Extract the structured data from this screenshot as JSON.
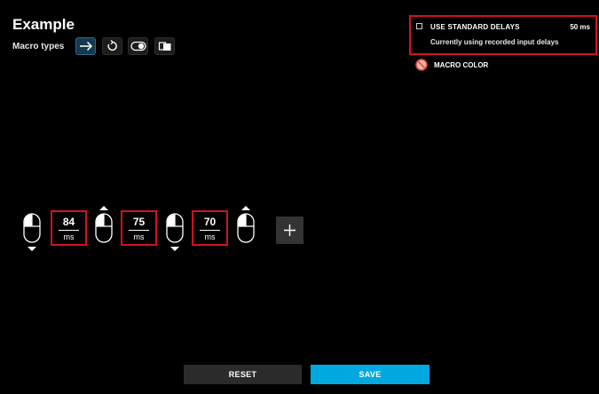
{
  "page": {
    "title": "Example"
  },
  "macro_types": {
    "label": "Macro types",
    "options": [
      {
        "icon": "arrow-right-icon",
        "active": true
      },
      {
        "icon": "loop-icon",
        "active": false
      },
      {
        "icon": "toggle-icon",
        "active": false
      },
      {
        "icon": "sequence-icon",
        "active": false
      }
    ]
  },
  "standard_delays": {
    "label": "USE STANDARD DELAYS",
    "value": "50 ms",
    "checked": false,
    "status": "Currently using recorded input delays"
  },
  "macro_color": {
    "label": "MACRO COLOR",
    "icon": "no-color-icon"
  },
  "sequence": {
    "events": [
      {
        "type": "left-click",
        "direction": "down"
      },
      {
        "type": "left-click",
        "direction": "up"
      },
      {
        "type": "left-click",
        "direction": "down"
      },
      {
        "type": "left-click",
        "direction": "up"
      }
    ],
    "delays": [
      {
        "value": "84",
        "unit": "ms"
      },
      {
        "value": "75",
        "unit": "ms"
      },
      {
        "value": "70",
        "unit": "ms"
      }
    ],
    "add_icon": "plus-icon"
  },
  "actions": {
    "reset_label": "RESET",
    "save_label": "SAVE"
  },
  "colors": {
    "accent": "#00a8e0",
    "highlight": "#d3121b",
    "background": "#000000"
  }
}
